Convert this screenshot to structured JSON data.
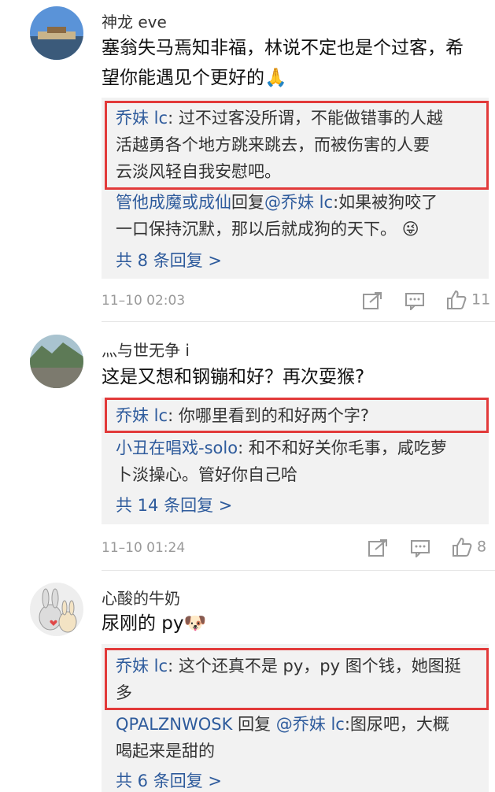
{
  "comments": [
    {
      "username": "神龙 eve",
      "content_lines": [
        "塞翁失马焉知非福，林说不定也是个过客，希",
        "望你能遇见个更好的"
      ],
      "emoji": "🙏",
      "replies": [
        {
          "author": "乔妹 lc",
          "text_lines": [
            "过不过客没所谓，不能做错事的人越",
            "活越勇各个地方跳来跳去，而被伤害的人要",
            "云淡风轻自我安慰吧。"
          ]
        },
        {
          "author": "管他成魔或成仙",
          "reply_word": "回复",
          "mention": "@乔妹 lc",
          "text_lines": [
            "如果被狗咬了",
            "一口保持沉默，那以后就成狗的天下。"
          ],
          "emoji": "😜"
        }
      ],
      "more": "共 8 条回复 >",
      "time": "11–10 02:03",
      "likes": "11"
    },
    {
      "username": "灬与世无争 i",
      "content_lines": [
        "这是又想和钢镚和好？再次耍猴?"
      ],
      "replies": [
        {
          "author": "乔妹 lc",
          "text_lines": [
            "你哪里看到的和好两个字?"
          ]
        },
        {
          "author": "小丑在唱戏-solo",
          "text_lines": [
            "和不和好关你毛事，咸吃萝",
            "卜淡操心。管好你自己哈"
          ]
        }
      ],
      "more": "共 14 条回复 >",
      "time": "11–10 01:24",
      "likes": "8"
    },
    {
      "username": "心酸的牛奶",
      "content_lines": [
        "尿刚的 py"
      ],
      "emoji": "🐶",
      "replies": [
        {
          "author": "乔妹 lc",
          "text_lines": [
            "这个还真不是 py，py 图个钱，她图挺",
            "多"
          ]
        },
        {
          "author": "QPALZNWOSK",
          "reply_word": "回复",
          "mention": "@乔妹 lc",
          "text_lines": [
            "图尿吧，大概",
            "喝起来是甜的"
          ]
        }
      ],
      "more": "共 6 条回复 >"
    }
  ],
  "colors": {
    "link": "#2e5b9c",
    "highlight": "#e23a3a",
    "reply_bg": "#f2f2f2",
    "meta": "#999999"
  }
}
